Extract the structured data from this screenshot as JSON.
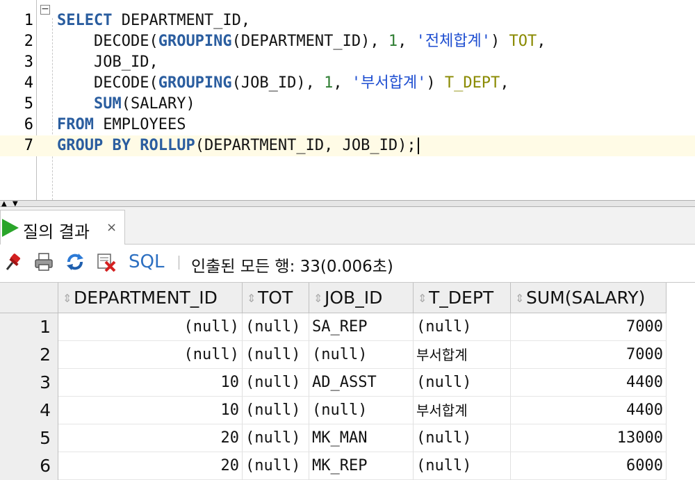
{
  "editor": {
    "line_numbers": [
      "1",
      "2",
      "3",
      "4",
      "5",
      "6",
      "7"
    ],
    "lines": [
      [
        {
          "t": "SELECT",
          "c": "kw"
        },
        {
          "t": " DEPARTMENT_ID,",
          "c": ""
        }
      ],
      [
        {
          "t": "    DECODE(",
          "c": ""
        },
        {
          "t": "GROUPING",
          "c": "kw"
        },
        {
          "t": "(DEPARTMENT_ID), ",
          "c": ""
        },
        {
          "t": "1",
          "c": "num"
        },
        {
          "t": ", ",
          "c": ""
        },
        {
          "t": "'전체합계'",
          "c": "str"
        },
        {
          "t": ") ",
          "c": ""
        },
        {
          "t": "TOT",
          "c": "alias"
        },
        {
          "t": ",",
          "c": ""
        }
      ],
      [
        {
          "t": "    JOB_ID,",
          "c": ""
        }
      ],
      [
        {
          "t": "    DECODE(",
          "c": ""
        },
        {
          "t": "GROUPING",
          "c": "kw"
        },
        {
          "t": "(JOB_ID), ",
          "c": ""
        },
        {
          "t": "1",
          "c": "num"
        },
        {
          "t": ", ",
          "c": ""
        },
        {
          "t": "'부서합계'",
          "c": "str"
        },
        {
          "t": ") ",
          "c": ""
        },
        {
          "t": "T_DEPT",
          "c": "alias"
        },
        {
          "t": ",",
          "c": ""
        }
      ],
      [
        {
          "t": "    ",
          "c": ""
        },
        {
          "t": "SUM",
          "c": "kw"
        },
        {
          "t": "(SALARY)",
          "c": ""
        }
      ],
      [
        {
          "t": "FROM",
          "c": "kw"
        },
        {
          "t": " EMPLOYEES",
          "c": ""
        }
      ],
      [
        {
          "t": "GROUP BY",
          "c": "kw"
        },
        {
          "t": " ",
          "c": ""
        },
        {
          "t": "ROLLUP",
          "c": "kw"
        },
        {
          "t": "(DEPARTMENT_ID, JOB_ID);",
          "c": ""
        }
      ]
    ],
    "fold_symbol": "−"
  },
  "results_tab": {
    "label": "질의 결과",
    "close": "×"
  },
  "toolbar": {
    "icons": [
      "pin-icon",
      "print-icon",
      "refresh-icon",
      "delete-icon"
    ],
    "sql_label": "SQL",
    "status": "인출된 모든 행: 33(0.006초)"
  },
  "grid": {
    "columns": [
      "DEPARTMENT_ID",
      "TOT",
      "JOB_ID",
      "T_DEPT",
      "SUM(SALARY)"
    ],
    "rows": [
      {
        "n": "1",
        "cells": [
          "(null)",
          "(null)",
          "SA_REP",
          "(null)",
          "7000"
        ]
      },
      {
        "n": "2",
        "cells": [
          "(null)",
          "(null)",
          "(null)",
          "부서합계",
          "7000"
        ]
      },
      {
        "n": "3",
        "cells": [
          "10",
          "(null)",
          "AD_ASST",
          "(null)",
          "4400"
        ]
      },
      {
        "n": "4",
        "cells": [
          "10",
          "(null)",
          "(null)",
          "부서합계",
          "4400"
        ]
      },
      {
        "n": "5",
        "cells": [
          "20",
          "(null)",
          "MK_MAN",
          "(null)",
          "13000"
        ]
      },
      {
        "n": "6",
        "cells": [
          "20",
          "(null)",
          "MK_REP",
          "(null)",
          "6000"
        ]
      }
    ]
  },
  "colors": {
    "keyword": "#2a5d9f",
    "string": "#1f4fd1",
    "number": "#2e7d32",
    "alias": "#8a8a00",
    "current_line": "#fffbe6",
    "accent": "#2c6fc1"
  }
}
